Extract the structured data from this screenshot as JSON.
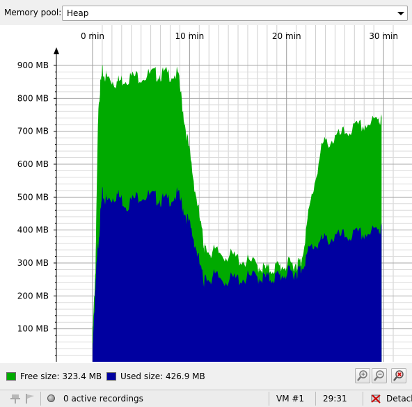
{
  "memory_pool": {
    "label": "Memory pool:",
    "selected": "Heap"
  },
  "legend": {
    "free_label": "Free size: 323.4 MB",
    "used_label": "Used size: 426.9 MB",
    "free_color": "#00aa00",
    "used_color": "#0000a0"
  },
  "status": {
    "recordings": "0 active recordings",
    "vm": "VM #1",
    "time": "29:31",
    "detach": "Detach"
  },
  "chart_data": {
    "type": "area",
    "xlabel": "",
    "ylabel": "",
    "x_unit": "min",
    "xlim": [
      0,
      31.5
    ],
    "ylim": [
      0,
      900
    ],
    "x_ticks": [
      {
        "value": 0,
        "label": "0 min"
      },
      {
        "value": 10,
        "label": "10 min"
      },
      {
        "value": 20,
        "label": "20 min"
      },
      {
        "value": 30,
        "label": "30 min"
      }
    ],
    "y_ticks": [
      {
        "value": 100,
        "label": "100 MB"
      },
      {
        "value": 200,
        "label": "200 MB"
      },
      {
        "value": 300,
        "label": "300 MB"
      },
      {
        "value": 400,
        "label": "400 MB"
      },
      {
        "value": 500,
        "label": "500 MB"
      },
      {
        "value": 600,
        "label": "600 MB"
      },
      {
        "value": 700,
        "label": "700 MB"
      },
      {
        "value": 800,
        "label": "800 MB"
      },
      {
        "value": 900,
        "label": "900 MB"
      }
    ],
    "grid": true,
    "series": [
      {
        "name": "Free size",
        "color": "#00aa00",
        "x": [
          0,
          0.3,
          0.6,
          1.0,
          1.5,
          2.5,
          3.5,
          5.0,
          6.5,
          7.5,
          8.8,
          9.6,
          10.5,
          11.4,
          11.6,
          12.5,
          14.0,
          15.5,
          17.0,
          18.0,
          19.0,
          20.0,
          21.0,
          21.5,
          22.5,
          23.7,
          25.0,
          26.5,
          28.0,
          29.5,
          29.8
        ],
        "values": [
          80,
          300,
          800,
          890,
          875,
          860,
          875,
          880,
          885,
          885,
          885,
          720,
          550,
          380,
          350,
          345,
          335,
          320,
          305,
          290,
          300,
          305,
          310,
          315,
          500,
          670,
          690,
          715,
          730,
          745,
          750
        ]
      },
      {
        "name": "Used size",
        "color": "#0000a0",
        "x": [
          0,
          0.3,
          0.6,
          1.0,
          1.5,
          2.5,
          3.5,
          5.0,
          6.5,
          7.5,
          8.8,
          9.6,
          10.5,
          11.4,
          11.6,
          12.5,
          14.0,
          15.5,
          17.0,
          18.0,
          19.0,
          20.0,
          21.0,
          21.5,
          22.5,
          23.7,
          25.0,
          26.5,
          28.0,
          29.5,
          29.8
        ],
        "values": [
          30,
          250,
          380,
          520,
          500,
          520,
          490,
          520,
          510,
          500,
          520,
          460,
          380,
          260,
          260,
          270,
          260,
          265,
          270,
          265,
          270,
          280,
          285,
          295,
          360,
          380,
          390,
          395,
          400,
          410,
          420
        ]
      }
    ]
  }
}
